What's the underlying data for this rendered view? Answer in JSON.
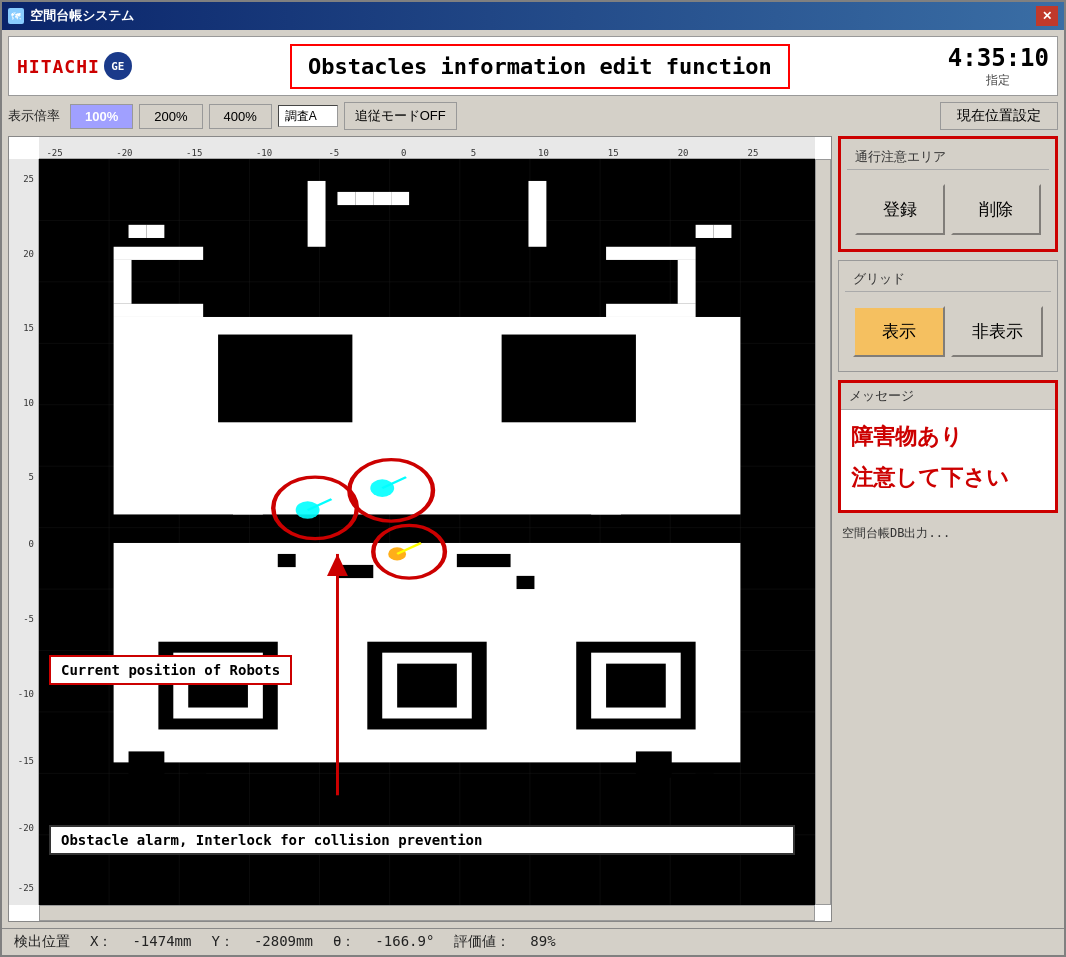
{
  "window": {
    "title": "空間台帳システム",
    "close_btn": "✕"
  },
  "header": {
    "logo_hitachi": "HITACHI",
    "logo_ge": "GE",
    "title": "Obstacles information  edit function",
    "clock": "4:35:10",
    "clock_label": "指定"
  },
  "zoom": {
    "label": "表示倍率",
    "btn_100": "100%",
    "btn_200": "200%",
    "btn_400": "400%",
    "survey_value": "調査A",
    "follow_mode": "追従モードOFF",
    "position_btn": "現在位置設定"
  },
  "right_panel": {
    "passage_title": "通行注意エリア",
    "register_btn": "登録",
    "delete_btn": "削除",
    "grid_title": "グリッド",
    "show_btn": "表示",
    "hide_btn": "非表示",
    "message_title": "メッセージ",
    "message_line1": "障害物あり",
    "message_line2": "注意して下さい",
    "db_output": "空間台帳DB出力..."
  },
  "annotations": {
    "robot_position": "Current position  of Robots",
    "obstacle_alarm": "Obstacle alarm,  Interlock for collision  prevention"
  },
  "ruler": {
    "top_ticks": [
      "-25",
      "-20",
      "-15",
      "-10",
      "-5",
      "0",
      "5",
      "10",
      "15",
      "20",
      "25"
    ],
    "left_ticks": [
      "25",
      "20",
      "15",
      "10",
      "5",
      "0",
      "-5",
      "-10",
      "-15",
      "-20",
      "-25"
    ]
  },
  "status_bar": {
    "label": "検出位置",
    "x_label": "X：",
    "x_value": "-1474mm",
    "y_label": "Y：",
    "y_value": "-2809mm",
    "theta_label": "θ：",
    "theta_value": "-166.9°",
    "eval_label": "評価値：",
    "eval_value": "89%"
  },
  "colors": {
    "accent_red": "#cc0000",
    "accent_blue": "#a0a0ff",
    "passage_border": "#cc0000",
    "message_border": "#cc0000",
    "grid_show_bg": "#f5c060",
    "window_title_bg": "#0a246a"
  }
}
